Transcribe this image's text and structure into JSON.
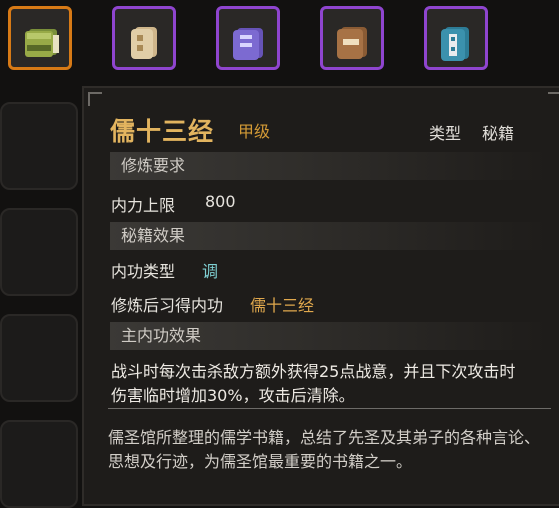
{
  "inventory": {
    "slots": [
      {
        "name": "book-green",
        "state": "selected"
      },
      {
        "name": "book-tan",
        "state": "epic"
      },
      {
        "name": "book-purple",
        "state": "epic"
      },
      {
        "name": "book-brown",
        "state": "epic"
      },
      {
        "name": "book-teal",
        "state": "epic"
      }
    ]
  },
  "tooltip": {
    "title": "儒十三经",
    "grade": "甲级",
    "type_label": "类型",
    "type_value": "秘籍",
    "sections": {
      "requirement": "修炼要求",
      "book_effect": "秘籍效果",
      "main_effect": "主内功效果"
    },
    "requirement_row": {
      "label": "内力上限",
      "value": "800"
    },
    "inner_type_row": {
      "label": "内功类型",
      "value": "调"
    },
    "learned_row": {
      "label": "修炼后习得内功",
      "value": "儒十三经"
    },
    "main_effect_text": "战斗时每次击杀敌方额外获得25点战意，并且下次攻击时伤害临时增加30%，攻击后清除。",
    "description": "儒圣馆所整理的儒学书籍，总结了先圣及其弟子的各种言论、思想及行迹，为儒圣馆最重要的书籍之一。"
  },
  "colors": {
    "title": "#e2b45f",
    "grade": "#d39a36",
    "inner_type_value": "#7fd0d3",
    "learned_value": "#e0a84d",
    "selected_border": "#d77a16",
    "epic_border": "#8f45cf"
  }
}
